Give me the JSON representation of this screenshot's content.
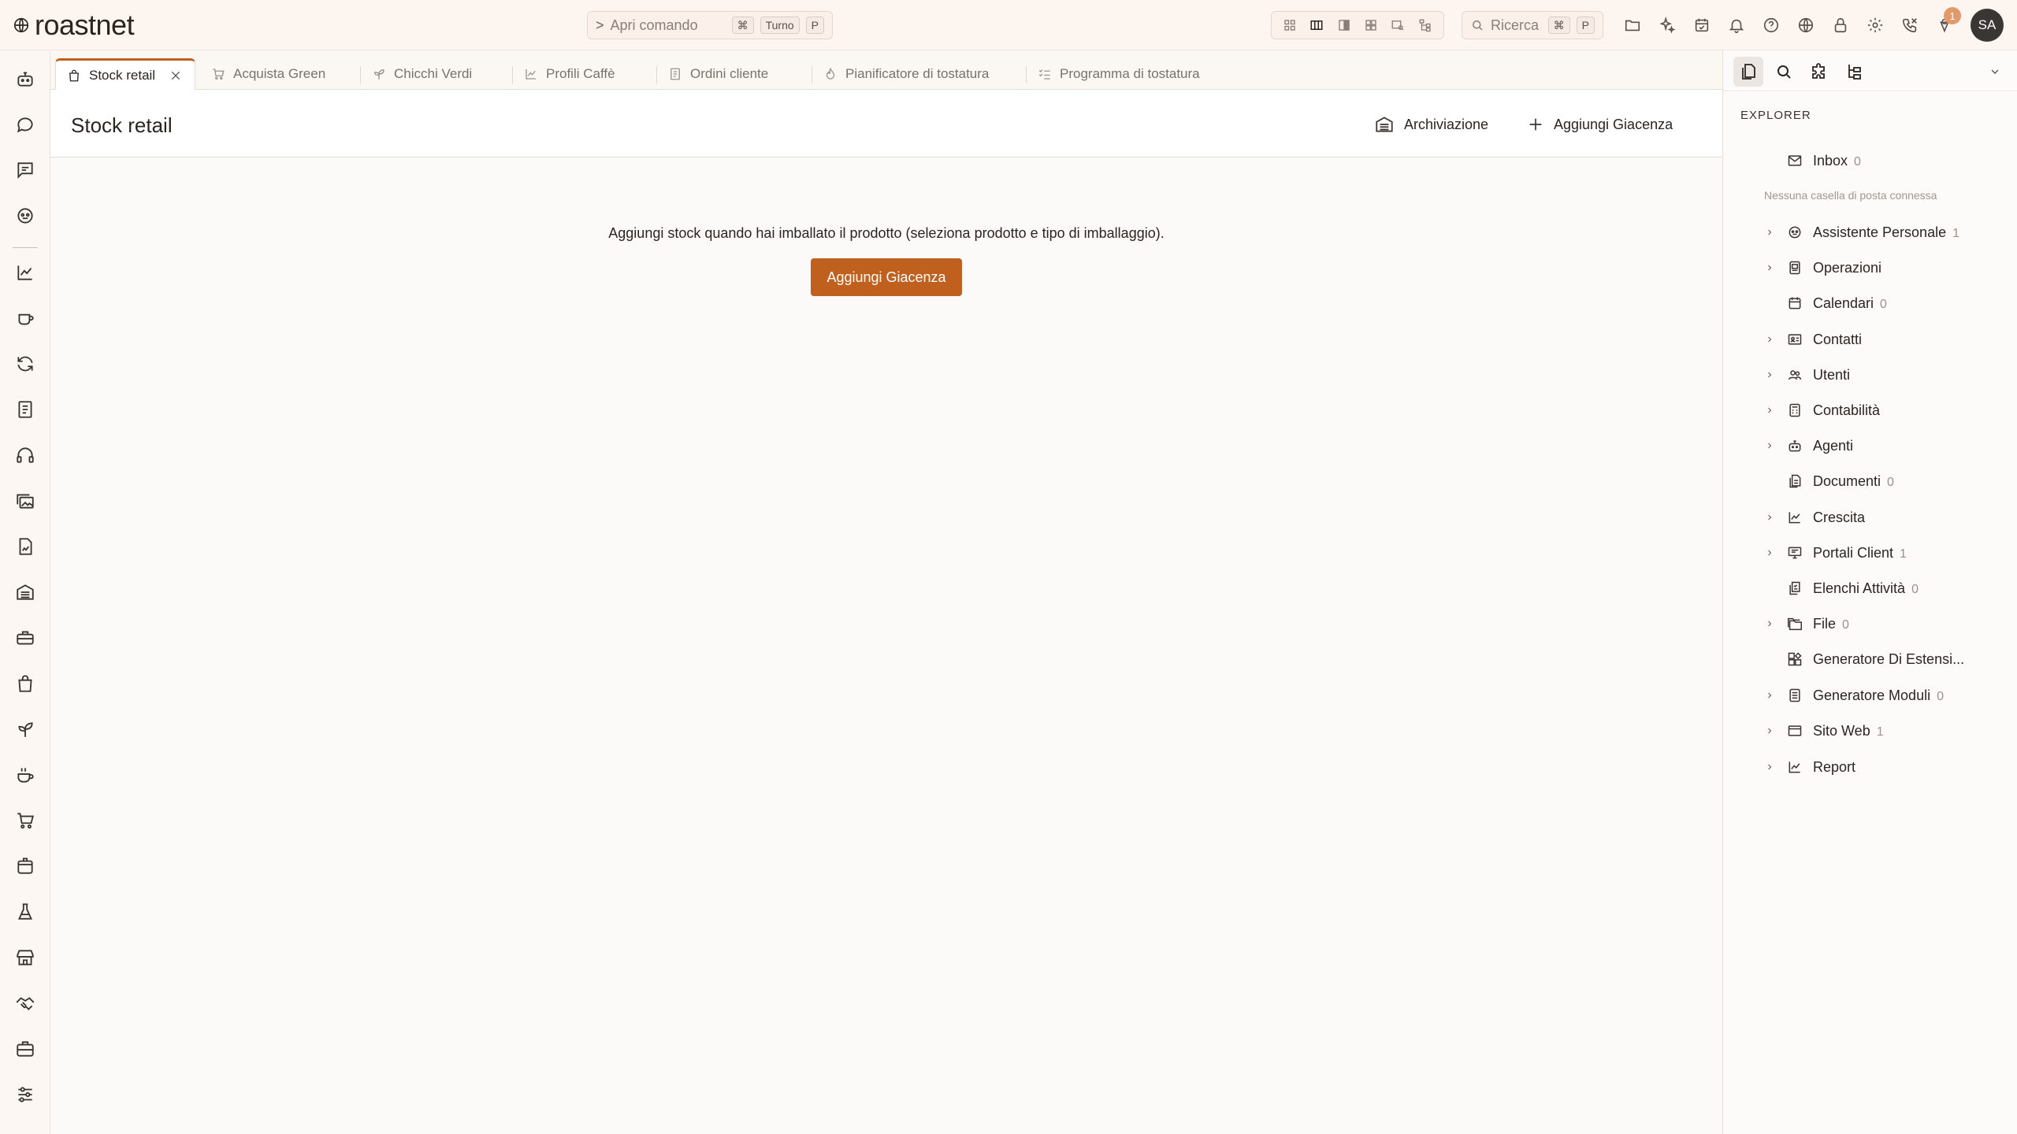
{
  "app": {
    "name": "roastnet"
  },
  "command_bar": {
    "chevron": ">",
    "label": "Apri comando",
    "keys": [
      "⌘",
      "Turno",
      "P"
    ]
  },
  "search": {
    "label": "Ricerca",
    "keys": [
      "⌘",
      "P"
    ]
  },
  "notifications": {
    "badge": "1"
  },
  "user": {
    "initials": "SA"
  },
  "tabs": [
    {
      "label": "Stock retail",
      "icon": "bag-icon",
      "active": true
    },
    {
      "label": "Acquista Green",
      "icon": "cart-icon"
    },
    {
      "label": "Chicchi Verdi",
      "icon": "sprout-icon"
    },
    {
      "label": "Profili Caffè",
      "icon": "chart-line-icon"
    },
    {
      "label": "Ordini cliente",
      "icon": "document-icon"
    },
    {
      "label": "Pianificatore di tostatura",
      "icon": "flame-icon"
    },
    {
      "label": "Programma di tostatura",
      "icon": "list-checks-icon"
    }
  ],
  "page": {
    "title": "Stock retail",
    "archive_label": "Archiviazione",
    "add_label": "Aggiungi Giacenza",
    "empty_text": "Aggiungi stock quando hai imballato il prodotto (seleziona prodotto e tipo di imballaggio).",
    "primary_button": "Aggiungi Giacenza"
  },
  "explorer": {
    "title": "EXPLORER",
    "inbox": {
      "label": "Inbox",
      "count": "0"
    },
    "no_mailbox_note": "Nessuna casella di posta connessa",
    "items": [
      {
        "label": "Assistente Personale",
        "count": "1",
        "expandable": true
      },
      {
        "label": "Operazioni",
        "count": "",
        "expandable": true
      },
      {
        "label": "Calendari",
        "count": "0",
        "expandable": false
      },
      {
        "label": "Contatti",
        "count": "",
        "expandable": true
      },
      {
        "label": "Utenti",
        "count": "",
        "expandable": true
      },
      {
        "label": "Contabilità",
        "count": "",
        "expandable": true
      },
      {
        "label": "Agenti",
        "count": "",
        "expandable": true
      },
      {
        "label": "Documenti",
        "count": "0",
        "expandable": false
      },
      {
        "label": "Crescita",
        "count": "",
        "expandable": true
      },
      {
        "label": "Portali Client",
        "count": "1",
        "expandable": true
      },
      {
        "label": "Elenchi Attività",
        "count": "0",
        "expandable": false
      },
      {
        "label": "File",
        "count": "0",
        "expandable": true
      },
      {
        "label": "Generatore Di Estensi...",
        "count": "",
        "expandable": false
      },
      {
        "label": "Generatore Moduli",
        "count": "0",
        "expandable": true
      },
      {
        "label": "Sito Web",
        "count": "1",
        "expandable": true
      },
      {
        "label": "Report",
        "count": "",
        "expandable": true
      }
    ]
  },
  "colors": {
    "accent": "#c0601f",
    "topbar_bg": "#fdf5f0",
    "badge": "#e19a6a",
    "avatar_bg": "#3a3633"
  }
}
